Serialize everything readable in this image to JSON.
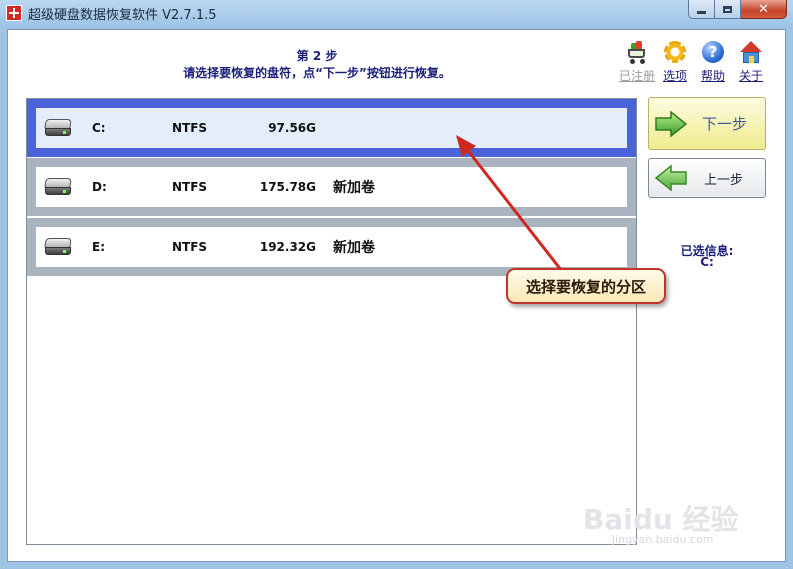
{
  "window": {
    "title": "超级硬盘数据恢复软件 V2.7.1.5",
    "controls": {
      "minimize": "minimize",
      "maximize": "maximize",
      "close": "✕"
    }
  },
  "header": {
    "step": "第 2 步",
    "instruction": "请选择要恢复的盘符，点“下一步”按钮进行恢复。"
  },
  "toolbar": {
    "items": [
      {
        "label": "已注册",
        "icon": "cart-icon",
        "enabled": false
      },
      {
        "label": "选项",
        "icon": "gear-icon",
        "enabled": true
      },
      {
        "label": "帮助",
        "icon": "help-icon",
        "enabled": true
      },
      {
        "label": "关于",
        "icon": "home-icon",
        "enabled": true
      }
    ]
  },
  "drives": [
    {
      "letter": "C:",
      "fs": "NTFS",
      "size": "97.56G",
      "label": "",
      "selected": true
    },
    {
      "letter": "D:",
      "fs": "NTFS",
      "size": "175.78G",
      "label": "新加卷",
      "selected": false
    },
    {
      "letter": "E:",
      "fs": "NTFS",
      "size": "192.32G",
      "label": "新加卷",
      "selected": false
    }
  ],
  "nav": {
    "next_label": "下一步",
    "prev_label": "上一步"
  },
  "info": {
    "title": "已选信息:",
    "value": "C:"
  },
  "annotation": {
    "text": "选择要恢复的分区"
  },
  "watermark": {
    "brand": "Baidu 经验",
    "url": "jingyan.baidu.com"
  },
  "colors": {
    "selected_row": "#4a63d8",
    "normal_row": "#aab4c0",
    "callout_border": "#c0342d",
    "heading_text": "#1b1f7a"
  }
}
